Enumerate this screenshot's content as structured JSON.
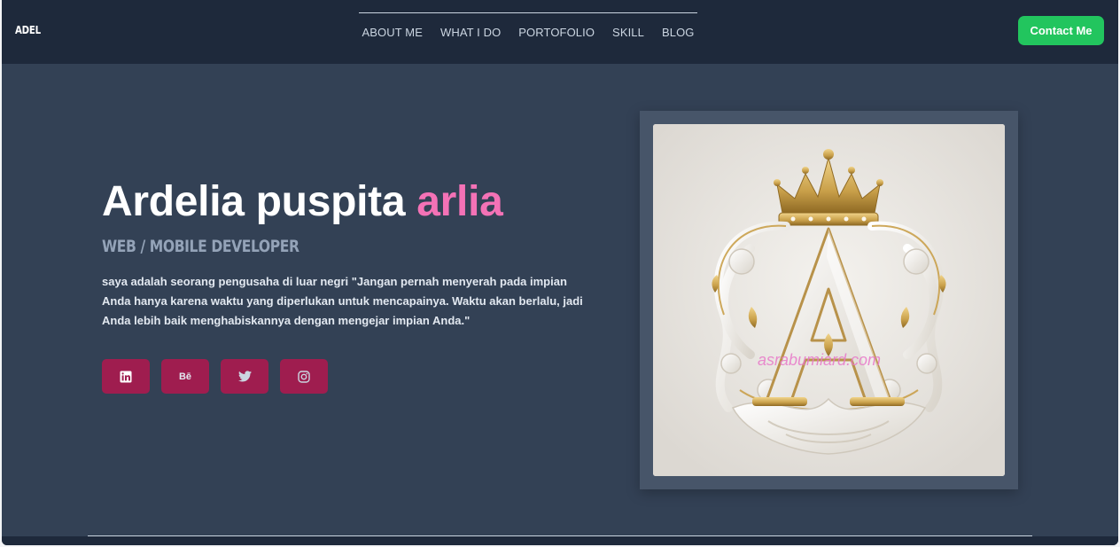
{
  "header": {
    "logo": "ADEL",
    "nav": [
      "ABOUT ME",
      "WHAT I DO",
      "PORTOFOLIO",
      "SKILL",
      "BLOG"
    ],
    "contact_label": "Contact Me"
  },
  "hero": {
    "name_main": "Ardelia puspita ",
    "name_accent": "arlia",
    "role": "WEB / MOBILE DEVELOPER",
    "description": "saya adalah seorang pengusaha di luar negri \"Jangan pernah menyerah pada impian Anda hanya karena waktu yang diperlukan untuk mencapainya. Waktu akan berlalu, jadi Anda lebih baik menghabiskannya dengan mengejar impian Anda.\"",
    "socials": [
      {
        "icon": "linkedin-icon"
      },
      {
        "icon": "behance-icon",
        "text": "Bē"
      },
      {
        "icon": "twitter-icon"
      },
      {
        "icon": "instagram-icon"
      }
    ]
  },
  "portrait": {
    "watermark": "asrabumiard.com"
  },
  "colors": {
    "header_bg": "#1e293b",
    "page_bg": "#334155",
    "accent_pink": "#f472b6",
    "contact_green": "#22c55e",
    "social_bg": "#9f1d4f"
  }
}
